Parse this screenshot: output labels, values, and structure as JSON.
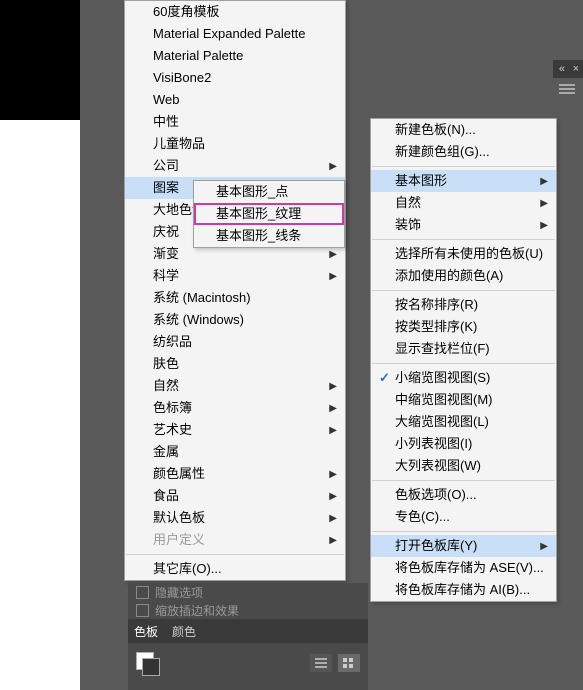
{
  "main_menu": {
    "items": [
      {
        "label": "60度角模板"
      },
      {
        "label": "Material Expanded Palette"
      },
      {
        "label": "Material Palette"
      },
      {
        "label": "VisiBone2"
      },
      {
        "label": "Web"
      },
      {
        "label": "中性"
      },
      {
        "label": "儿童物品"
      },
      {
        "label": "公司",
        "submenu": true
      },
      {
        "label": "图案",
        "submenu": true,
        "highlight": true
      },
      {
        "label": "大地色调",
        "submenu": true
      },
      {
        "label": "庆祝",
        "submenu": true
      },
      {
        "label": "渐变",
        "submenu": true
      },
      {
        "label": "科学",
        "submenu": true
      },
      {
        "label": "系统 (Macintosh)"
      },
      {
        "label": "系统 (Windows)"
      },
      {
        "label": "纺织品"
      },
      {
        "label": "肤色"
      },
      {
        "label": "自然",
        "submenu": true
      },
      {
        "label": "色标簿",
        "submenu": true
      },
      {
        "label": "艺术史",
        "submenu": true
      },
      {
        "label": "金属"
      },
      {
        "label": "颜色属性",
        "submenu": true
      },
      {
        "label": "食品",
        "submenu": true
      },
      {
        "label": "默认色板",
        "submenu": true
      },
      {
        "label": "用户定义",
        "submenu": true,
        "disabled": true
      }
    ],
    "other_lib": "其它库(O)..."
  },
  "sub_menu1": {
    "items": [
      {
        "label": "基本图形_点"
      },
      {
        "label": "基本图形_纹理",
        "selected": true
      },
      {
        "label": "基本图形_线条"
      }
    ]
  },
  "right_menu": {
    "groups": [
      [
        {
          "label": "新建色板(N)..."
        },
        {
          "label": "新建颜色组(G)..."
        }
      ],
      [
        {
          "label": "基本图形",
          "submenu": true,
          "highlight": true
        },
        {
          "label": "自然",
          "submenu": true
        },
        {
          "label": "装饰",
          "submenu": true
        }
      ],
      [
        {
          "label": "选择所有未使用的色板(U)"
        },
        {
          "label": "添加使用的颜色(A)"
        }
      ],
      [
        {
          "label": "按名称排序(R)"
        },
        {
          "label": "按类型排序(K)"
        },
        {
          "label": "显示查找栏位(F)"
        }
      ],
      [
        {
          "label": "小缩览图视图(S)",
          "checked": true
        },
        {
          "label": "中缩览图视图(M)"
        },
        {
          "label": "大缩览图视图(L)"
        },
        {
          "label": "小列表视图(I)"
        },
        {
          "label": "大列表视图(W)"
        }
      ],
      [
        {
          "label": "色板选项(O)..."
        },
        {
          "label": "专色(C)..."
        }
      ],
      [
        {
          "label": "打开色板库(Y)",
          "submenu": true,
          "highlight": true
        },
        {
          "label": "将色板库存储为 ASE(V)..."
        },
        {
          "label": "将色板库存储为 AI(B)..."
        }
      ]
    ]
  },
  "panel": {
    "hidden1": "隐藏选项",
    "hidden2": "缩放插边和效果",
    "tab_active": "色板",
    "tab_inactive": "颜色"
  }
}
